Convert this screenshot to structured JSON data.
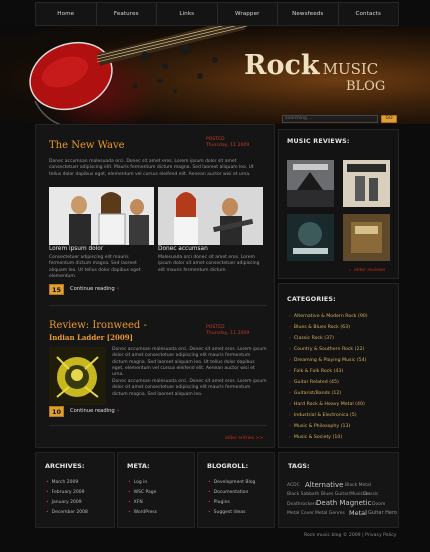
{
  "nav": [
    "Home",
    "Features",
    "Links",
    "Wrapper",
    "Newsfeeds",
    "Contacts"
  ],
  "logo": {
    "rock": "Rock",
    "music": "MUSIC",
    "blog": "BLOG"
  },
  "search": {
    "placeholder": "searching ...",
    "button": "GO"
  },
  "posts": [
    {
      "title": "The New Wave",
      "meta1": "POSTED",
      "meta2": "Thursday, 11 2009",
      "text": "Donec accumsan malesuada orci. Donec sit amet eros. Lorem ipsum dolor sit amet consectetuer adipiscing elit. Mauris fermentum dictum magna. Sed laoreet aliquam leo. Ut tellus dolor dapibus eget, elementum vel cursus eleifend elit. Aenean auctor wisi et urna.",
      "left_caption": "Lorem ipsum dolor",
      "left_text": "Consectetuer adipiscing elit mauris fermentum dictum magna. Sed laoreet aliquam leo. Ut tellus dolor dapibus eget elementum.",
      "right_caption": "Donec accumsan",
      "right_text": "Malesuada orci donec sit amet eros. Lorem ipsum dolor sit amet consectetuer adipiscing elit mauris fermentum dictum.",
      "number": "15",
      "continue": "Continue reading"
    },
    {
      "title": "Review: Ironweed -",
      "subtitle": "Indian Ladder [2009]",
      "meta1": "POSTED",
      "meta2": "Thursday, 11 2009",
      "text": "Donec accumsan malesuada orci. Donec sit amet eros. Lorem ipsum dolor sit amet consectetuer adipiscing elit mauris fermentum dictum magna. Sed laoreet aliquam leo. Ut tellus dolor dapibus eget, elementum vel cursus eleifend elit. Aenean auctor wisi et urna.",
      "text2": "Donec accumsan malesuada orci. Donec sit amet eros. Lorem ipsum dolor sit amet consectetuer adipiscing elit mauris fermentum dictum magna. Sed laoreet aliquam leo.",
      "number": "10",
      "continue": "Continue reading"
    }
  ],
  "older": "older entries >>",
  "reviews": {
    "title": "MUSIC REVIEWS:",
    "more": "older reviews"
  },
  "categories": {
    "title": "CATEGORIES:",
    "items": [
      "Alternative & Modern Rock (90)",
      "Blues & Blues Rock (63)",
      "Classic Rock (37)",
      "Country & Southern Rock (22)",
      "Dreaming & Playing Music (54)",
      "Folk & Folk Rock (43)",
      "Guitar Related (45)",
      "Guitarist/Bands (12)",
      "Hard Rock & Heavy Metal (40)",
      "Industrial & Electronica (5)",
      "Music & Philosophy (13)",
      "Music & Society (10)"
    ]
  },
  "footer": {
    "archives": {
      "title": "ARCHIVES:",
      "items": [
        "March 2009",
        "February 2009",
        "January 2009",
        "December 2008"
      ]
    },
    "meta": {
      "title": "META:",
      "items": [
        "Log in",
        "WSC Page",
        "XFN",
        "WordPress"
      ]
    },
    "blogroll": {
      "title": "BLOGROLL:",
      "items": [
        "Development Blog",
        "Documentation",
        "Plugins",
        "Suggest Ideas"
      ]
    },
    "tags": {
      "title": "TAGS:",
      "items": [
        "ACDC",
        "Alternative",
        "Black Metal",
        "Black Sabbath",
        "Blues Guitar/Musician",
        "Classic",
        "Deathrockers",
        "Death Magnetic",
        "Doom",
        "Metal Cover",
        "Metal Genres",
        "Metal",
        "Guitar Hero"
      ]
    }
  },
  "copyright": "Rock music blog © 2009 | Privacy Policy"
}
